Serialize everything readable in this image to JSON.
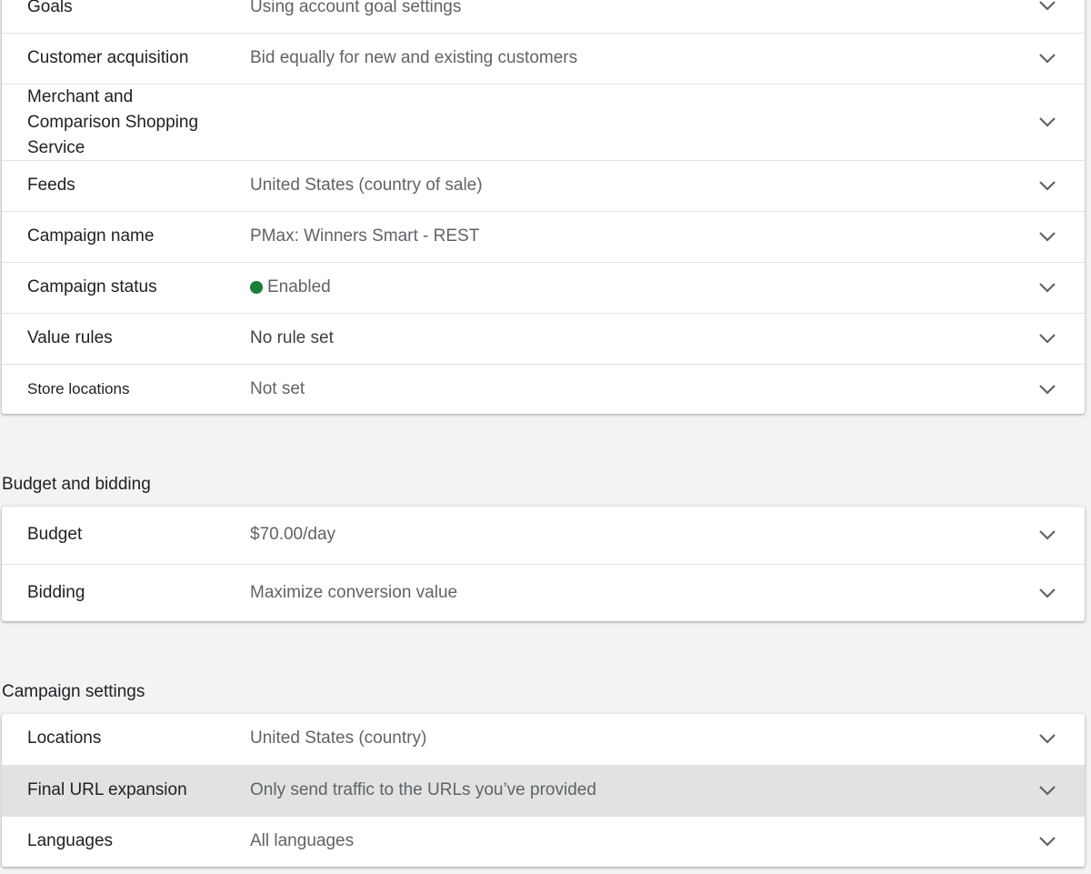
{
  "colors": {
    "enabled_status": "#188038",
    "chevron": "#5f6368",
    "highlight_row": "#e1e2e2"
  },
  "general_settings": {
    "rows": [
      {
        "label": "Goals",
        "value": "Using account goal settings"
      },
      {
        "label": "Customer acquisition",
        "value": "Bid equally for new and existing customers"
      },
      {
        "label": "Merchant and Comparison Shopping Service",
        "value": ""
      },
      {
        "label": "Feeds",
        "value": "United States (country of sale)"
      },
      {
        "label": "Campaign name",
        "value": "PMax: Winners Smart - REST"
      },
      {
        "label": "Campaign status",
        "value": "Enabled"
      },
      {
        "label": "Value rules",
        "value": "No rule set"
      },
      {
        "label": "Store locations",
        "value": "Not set"
      }
    ]
  },
  "budget_section": {
    "title": "Budget and bidding",
    "rows": [
      {
        "label": "Budget",
        "value": "$70.00/day"
      },
      {
        "label": "Bidding",
        "value": "Maximize conversion value"
      }
    ]
  },
  "campaign_section": {
    "title": "Campaign settings",
    "rows": [
      {
        "label": "Locations",
        "value": "United States (country)"
      },
      {
        "label": "Final URL expansion",
        "value": "Only send traffic to the URLs you’ve provided"
      },
      {
        "label": "Languages",
        "value": "All languages"
      }
    ]
  },
  "icons": {
    "expand": "chevron-down-icon",
    "status": "status-dot-icon"
  }
}
